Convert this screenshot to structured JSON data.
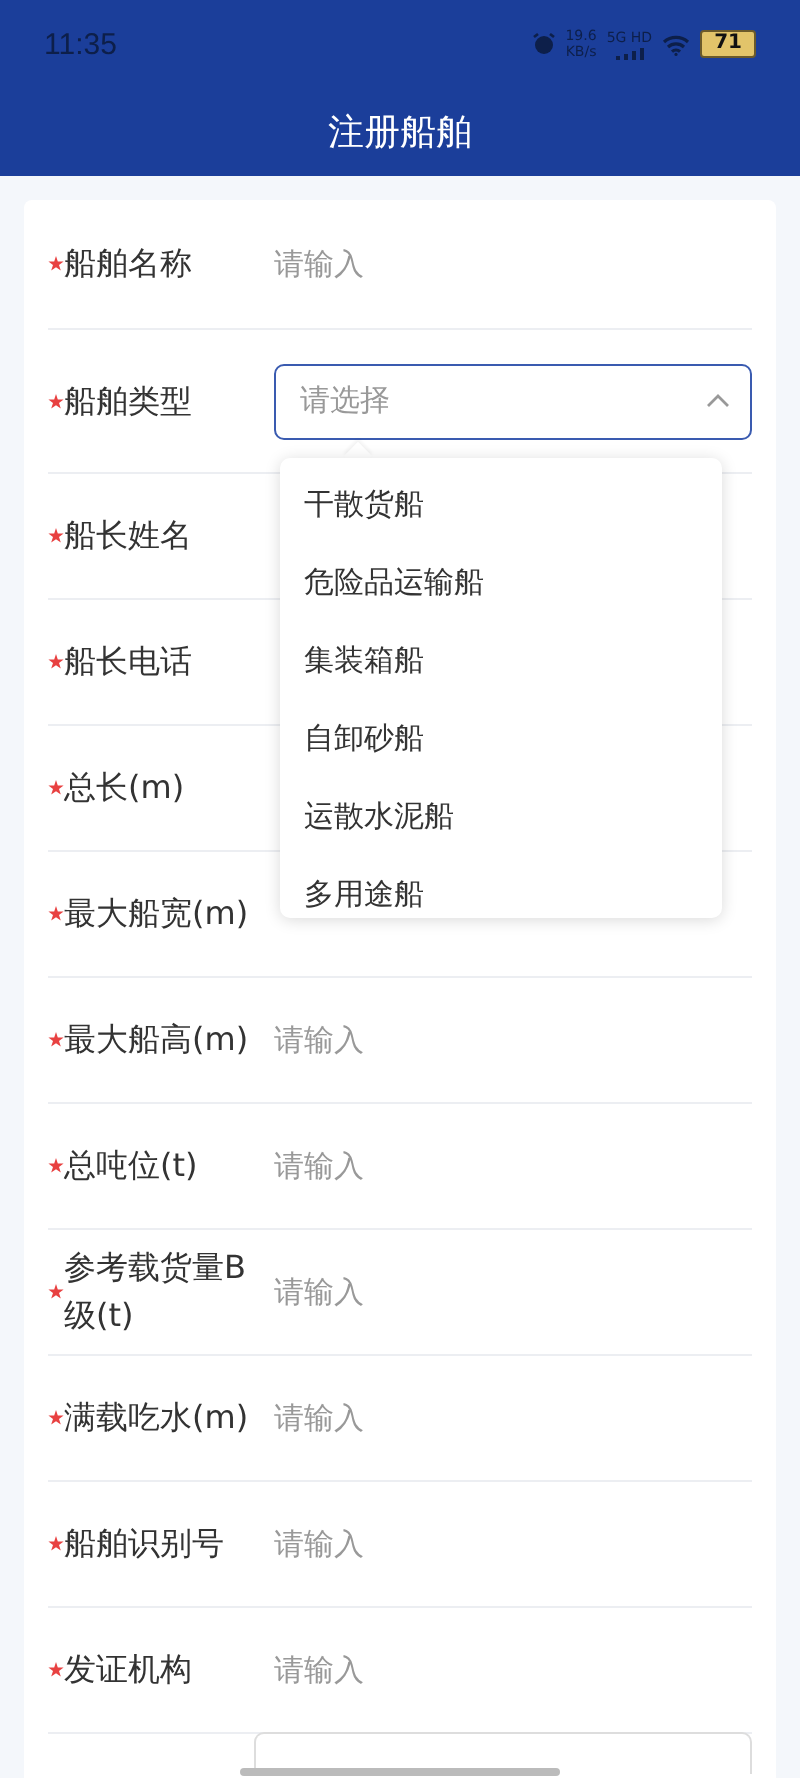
{
  "status_bar": {
    "time": "11:35",
    "network_speed": "19.6",
    "network_speed_unit": "KB/s",
    "network_type": "5G HD",
    "battery": "71"
  },
  "header": {
    "title": "注册船舶"
  },
  "fields": [
    {
      "kind": "input",
      "required": true,
      "label": "船舶名称",
      "placeholder": "请输入"
    },
    {
      "kind": "select",
      "required": true,
      "label": "船舶类型",
      "placeholder": "请选择",
      "expanded": true
    },
    {
      "kind": "input",
      "required": true,
      "label": "船长姓名"
    },
    {
      "kind": "input",
      "required": true,
      "label": "船长电话"
    },
    {
      "kind": "input",
      "required": true,
      "label": "总长(m)"
    },
    {
      "kind": "input",
      "required": true,
      "label": "最大船宽(m)"
    },
    {
      "kind": "input",
      "required": true,
      "label": "最大船高(m)",
      "placeholder": "请输入"
    },
    {
      "kind": "input",
      "required": true,
      "label": "总吨位(t)",
      "placeholder": "请输入"
    },
    {
      "kind": "input",
      "required": true,
      "label": "参考载货量B级(t)",
      "placeholder": "请输入"
    },
    {
      "kind": "input",
      "required": true,
      "label": "满载吃水(m)",
      "placeholder": "请输入"
    },
    {
      "kind": "input",
      "required": true,
      "label": "船舶识别号",
      "placeholder": "请输入"
    },
    {
      "kind": "input",
      "required": true,
      "label": "发证机构",
      "placeholder": "请输入"
    },
    {
      "kind": "box"
    }
  ],
  "dropdown": {
    "options": [
      "干散货船",
      "危险品运输船",
      "集装箱船",
      "自卸砂船",
      "运散水泥船",
      "多用途船"
    ]
  }
}
